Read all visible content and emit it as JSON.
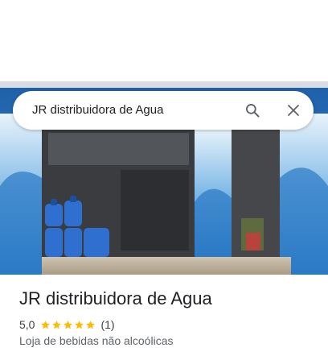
{
  "search": {
    "query": "JR distribuidora de Agua"
  },
  "place": {
    "name": "JR distribuidora de Agua",
    "rating": "5,0",
    "star_count": 5,
    "review_count": "(1)",
    "category": "Loja de bebidas não alcoólicas"
  },
  "colors": {
    "star": "#fbbc04",
    "icon": "#5f6368",
    "text": "#202124"
  },
  "icons": {
    "search": "search-icon",
    "clear": "close-icon"
  }
}
